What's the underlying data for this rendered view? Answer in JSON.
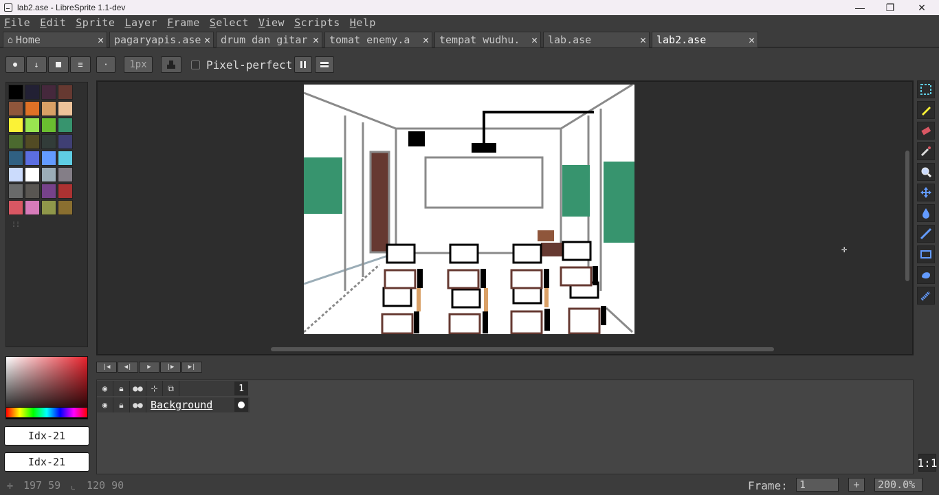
{
  "window": {
    "title": "lab2.ase - LibreSprite 1.1-dev",
    "minimize": "—",
    "maximize": "❐",
    "close": "✕"
  },
  "menu": [
    "File",
    "Edit",
    "Sprite",
    "Layer",
    "Frame",
    "Select",
    "View",
    "Scripts",
    "Help"
  ],
  "tabs": [
    {
      "label": "Home",
      "icon": "home-icon"
    },
    {
      "label": "pagaryapis.ase"
    },
    {
      "label": "drum dan gitar"
    },
    {
      "label": "tomat enemy.a"
    },
    {
      "label": "tempat wudhu."
    },
    {
      "label": "lab.ase"
    },
    {
      "label": "lab2.ase",
      "active": true
    }
  ],
  "tab_close": "✕",
  "toolbar": {
    "brush_size": "1px",
    "pixel_perfect": "Pixel-perfect"
  },
  "palette": {
    "colors": [
      "#000000",
      "#222034",
      "#45283c",
      "#663931",
      "#8f563b",
      "#df7126",
      "#d9a066",
      "#eec39a",
      "#fbf236",
      "#99e550",
      "#6abe30",
      "#37946e",
      "#4b692f",
      "#524b24",
      "#323c39",
      "#3f3f74",
      "#306082",
      "#5b6ee1",
      "#639bff",
      "#5fcde4",
      "#cbdbfc",
      "#ffffff",
      "#9badb7",
      "#847e87",
      "#696a6a",
      "#595652",
      "#76428a",
      "#ac3232",
      "#d95763",
      "#d77bba",
      "#8f974a",
      "#8a6f30"
    ]
  },
  "color_fields": {
    "foreground": "Idx-21",
    "background": "Idx-21"
  },
  "layers": {
    "name": "Background",
    "frame_number": "1"
  },
  "status": {
    "position": "197 59",
    "size": "120 90",
    "frame_label": "Frame:",
    "frame_value": "1",
    "add_frame": "+",
    "zoom": "200.0%",
    "one_to_one": "1:1"
  }
}
